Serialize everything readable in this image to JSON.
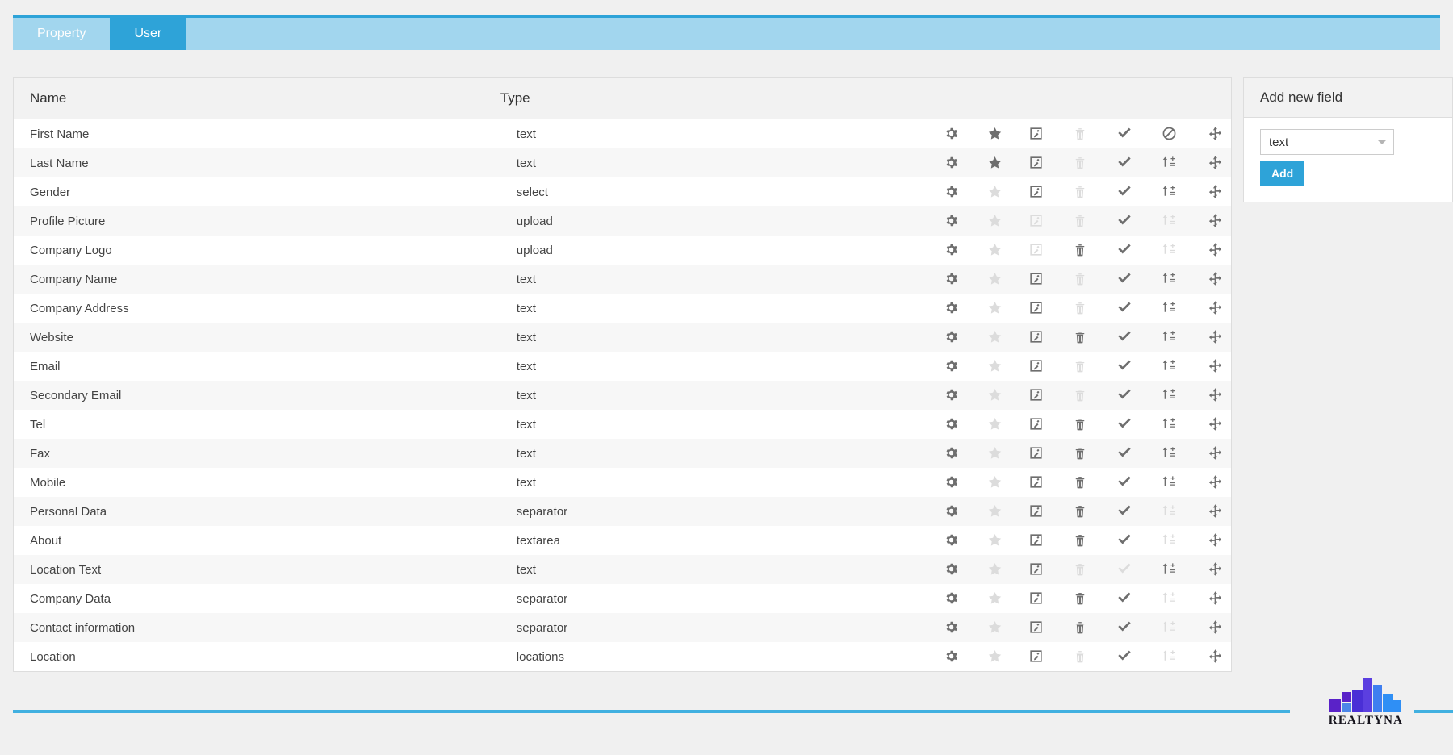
{
  "tabs": [
    {
      "label": "Property",
      "active": false
    },
    {
      "label": "User",
      "active": true
    }
  ],
  "table": {
    "columns": {
      "name": "Name",
      "type": "Type"
    },
    "icon_columns": [
      "settings-icon",
      "star-icon",
      "edit-icon",
      "trash-icon",
      "check-icon",
      "sort-icon",
      "move-icon"
    ],
    "rows": [
      {
        "name": "First Name",
        "type": "text",
        "icons": [
          "on",
          "on",
          "on",
          "off",
          "on",
          "ban-on",
          "on"
        ]
      },
      {
        "name": "Last Name",
        "type": "text",
        "icons": [
          "on",
          "on",
          "on",
          "off",
          "on",
          "on",
          "on"
        ]
      },
      {
        "name": "Gender",
        "type": "select",
        "icons": [
          "on",
          "off",
          "on",
          "off",
          "on",
          "on",
          "on"
        ]
      },
      {
        "name": "Profile Picture",
        "type": "upload",
        "icons": [
          "on",
          "off",
          "off",
          "off",
          "on",
          "off",
          "on"
        ]
      },
      {
        "name": "Company Logo",
        "type": "upload",
        "icons": [
          "on",
          "off",
          "off",
          "on",
          "on",
          "off",
          "on"
        ]
      },
      {
        "name": "Company Name",
        "type": "text",
        "icons": [
          "on",
          "off",
          "on",
          "off",
          "on",
          "on",
          "on"
        ]
      },
      {
        "name": "Company Address",
        "type": "text",
        "icons": [
          "on",
          "off",
          "on",
          "off",
          "on",
          "on",
          "on"
        ]
      },
      {
        "name": "Website",
        "type": "text",
        "icons": [
          "on",
          "off",
          "on",
          "on",
          "on",
          "on",
          "on"
        ]
      },
      {
        "name": "Email",
        "type": "text",
        "icons": [
          "on",
          "off",
          "on",
          "off",
          "on",
          "on",
          "on"
        ]
      },
      {
        "name": "Secondary Email",
        "type": "text",
        "icons": [
          "on",
          "off",
          "on",
          "off",
          "on",
          "on",
          "on"
        ]
      },
      {
        "name": "Tel",
        "type": "text",
        "icons": [
          "on",
          "off",
          "on",
          "on",
          "on",
          "on",
          "on"
        ]
      },
      {
        "name": "Fax",
        "type": "text",
        "icons": [
          "on",
          "off",
          "on",
          "on",
          "on",
          "on",
          "on"
        ]
      },
      {
        "name": "Mobile",
        "type": "text",
        "icons": [
          "on",
          "off",
          "on",
          "on",
          "on",
          "on",
          "on"
        ]
      },
      {
        "name": "Personal Data",
        "type": "separator",
        "icons": [
          "on",
          "off",
          "on",
          "on",
          "on",
          "off",
          "on"
        ]
      },
      {
        "name": "About",
        "type": "textarea",
        "icons": [
          "on",
          "off",
          "on",
          "on",
          "on",
          "off",
          "on"
        ]
      },
      {
        "name": "Location Text",
        "type": "text",
        "icons": [
          "on",
          "off",
          "on",
          "off",
          "off",
          "on",
          "on"
        ]
      },
      {
        "name": "Company Data",
        "type": "separator",
        "icons": [
          "on",
          "off",
          "on",
          "on",
          "on",
          "off",
          "on"
        ]
      },
      {
        "name": "Contact information",
        "type": "separator",
        "icons": [
          "on",
          "off",
          "on",
          "on",
          "on",
          "off",
          "on"
        ]
      },
      {
        "name": "Location",
        "type": "locations",
        "icons": [
          "on",
          "off",
          "on",
          "off",
          "on",
          "off",
          "on"
        ]
      }
    ]
  },
  "side_panel": {
    "title": "Add new field",
    "select_value": "text",
    "add_label": "Add"
  },
  "footer": {
    "brand": "REALTYNA"
  },
  "colors": {
    "accent": "#2ea3d8",
    "tab_inactive": "#a2d6ee",
    "rule": "#41b0e0",
    "icon_on": "#6e6e6e",
    "icon_off": "#dcdcdc"
  }
}
